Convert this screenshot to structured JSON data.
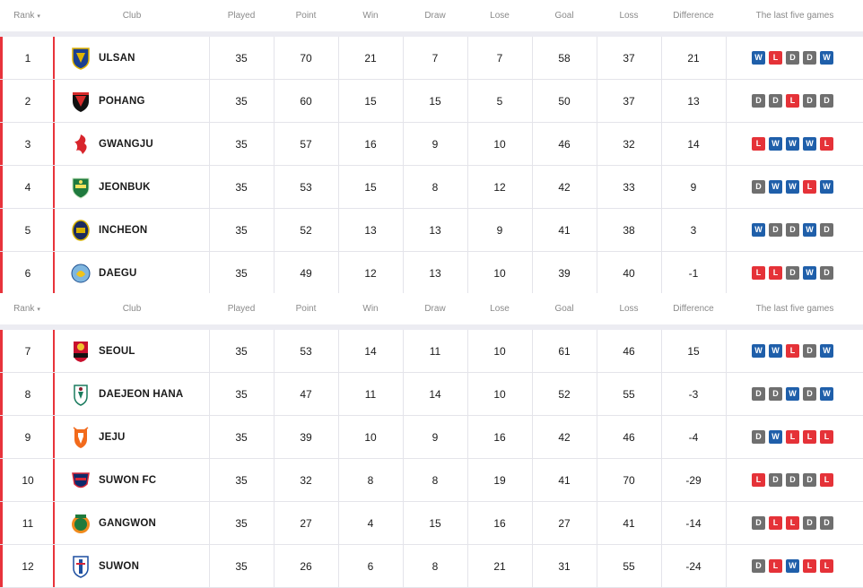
{
  "headers": {
    "rank": "Rank",
    "club": "Club",
    "played": "Played",
    "point": "Point",
    "win": "Win",
    "draw": "Draw",
    "lose": "Lose",
    "goal": "Goal",
    "loss": "Loss",
    "difference": "Difference",
    "last_five": "The last five games"
  },
  "colors": {
    "accent_red": "#e8333b",
    "win": "#1f5faa",
    "draw": "#6f6f6f",
    "lose": "#e53238"
  },
  "group_a": [
    {
      "rank": "1",
      "club": "ULSAN",
      "logo": "ulsan-crest-icon",
      "played": "35",
      "point": "70",
      "win": "21",
      "draw": "7",
      "lose": "7",
      "goal": "58",
      "loss": "37",
      "difference": "21",
      "form": [
        "W",
        "L",
        "D",
        "D",
        "W"
      ]
    },
    {
      "rank": "2",
      "club": "POHANG",
      "logo": "pohang-crest-icon",
      "played": "35",
      "point": "60",
      "win": "15",
      "draw": "15",
      "lose": "5",
      "goal": "50",
      "loss": "37",
      "difference": "13",
      "form": [
        "D",
        "D",
        "L",
        "D",
        "D"
      ]
    },
    {
      "rank": "3",
      "club": "GWANGJU",
      "logo": "gwangju-crest-icon",
      "played": "35",
      "point": "57",
      "win": "16",
      "draw": "9",
      "lose": "10",
      "goal": "46",
      "loss": "32",
      "difference": "14",
      "form": [
        "L",
        "W",
        "W",
        "W",
        "L"
      ]
    },
    {
      "rank": "4",
      "club": "JEONBUK",
      "logo": "jeonbuk-crest-icon",
      "played": "35",
      "point": "53",
      "win": "15",
      "draw": "8",
      "lose": "12",
      "goal": "42",
      "loss": "33",
      "difference": "9",
      "form": [
        "D",
        "W",
        "W",
        "L",
        "W"
      ]
    },
    {
      "rank": "5",
      "club": "INCHEON",
      "logo": "incheon-crest-icon",
      "played": "35",
      "point": "52",
      "win": "13",
      "draw": "13",
      "lose": "9",
      "goal": "41",
      "loss": "38",
      "difference": "3",
      "form": [
        "W",
        "D",
        "D",
        "W",
        "D"
      ]
    },
    {
      "rank": "6",
      "club": "DAEGU",
      "logo": "daegu-crest-icon",
      "played": "35",
      "point": "49",
      "win": "12",
      "draw": "13",
      "lose": "10",
      "goal": "39",
      "loss": "40",
      "difference": "-1",
      "form": [
        "L",
        "L",
        "D",
        "W",
        "D"
      ]
    }
  ],
  "group_b": [
    {
      "rank": "7",
      "club": "SEOUL",
      "logo": "seoul-crest-icon",
      "played": "35",
      "point": "53",
      "win": "14",
      "draw": "11",
      "lose": "10",
      "goal": "61",
      "loss": "46",
      "difference": "15",
      "form": [
        "W",
        "W",
        "L",
        "D",
        "W"
      ]
    },
    {
      "rank": "8",
      "club": "DAEJEON HANA",
      "logo": "daejeon-crest-icon",
      "played": "35",
      "point": "47",
      "win": "11",
      "draw": "14",
      "lose": "10",
      "goal": "52",
      "loss": "55",
      "difference": "-3",
      "form": [
        "D",
        "D",
        "W",
        "D",
        "W"
      ]
    },
    {
      "rank": "9",
      "club": "JEJU",
      "logo": "jeju-crest-icon",
      "played": "35",
      "point": "39",
      "win": "10",
      "draw": "9",
      "lose": "16",
      "goal": "42",
      "loss": "46",
      "difference": "-4",
      "form": [
        "D",
        "W",
        "L",
        "L",
        "L"
      ]
    },
    {
      "rank": "10",
      "club": "SUWON FC",
      "logo": "suwonfc-crest-icon",
      "played": "35",
      "point": "32",
      "win": "8",
      "draw": "8",
      "lose": "19",
      "goal": "41",
      "loss": "70",
      "difference": "-29",
      "form": [
        "L",
        "D",
        "D",
        "D",
        "L"
      ]
    },
    {
      "rank": "11",
      "club": "GANGWON",
      "logo": "gangwon-crest-icon",
      "played": "35",
      "point": "27",
      "win": "4",
      "draw": "15",
      "lose": "16",
      "goal": "27",
      "loss": "41",
      "difference": "-14",
      "form": [
        "D",
        "L",
        "L",
        "D",
        "D"
      ]
    },
    {
      "rank": "12",
      "club": "SUWON",
      "logo": "suwon-crest-icon",
      "played": "35",
      "point": "26",
      "win": "6",
      "draw": "8",
      "lose": "21",
      "goal": "31",
      "loss": "55",
      "difference": "-24",
      "form": [
        "D",
        "L",
        "W",
        "L",
        "L"
      ]
    }
  ]
}
